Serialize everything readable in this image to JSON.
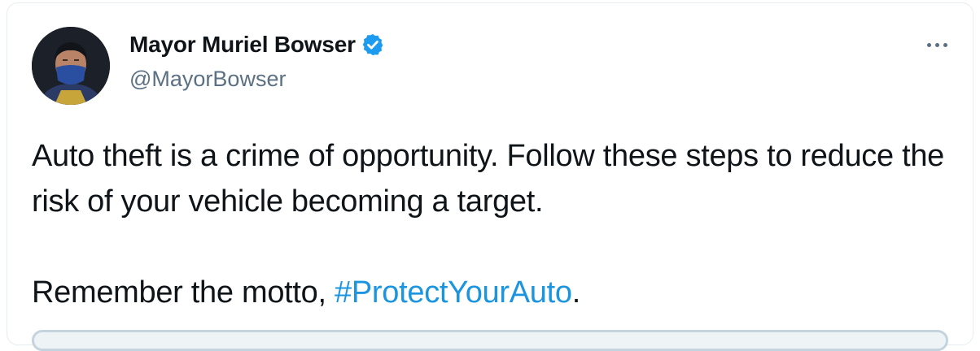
{
  "author": {
    "name": "Mayor Muriel Bowser",
    "handle": "@MayorBowser",
    "verified": true,
    "avatar": "profile-photo"
  },
  "menu": {
    "icon": "more-horizontal-icon"
  },
  "tweet": {
    "line1": "Auto theft is a crime of opportunity. Follow these steps to reduce the risk of your vehicle becoming a target.",
    "line2_prefix": "Remember the motto, ",
    "hashtag": "#ProtectYourAuto",
    "line2_suffix": "."
  },
  "colors": {
    "text": "#0f1419",
    "secondary": "#5b7083",
    "link": "#1b95e0",
    "verified": "#1d9bf0"
  }
}
